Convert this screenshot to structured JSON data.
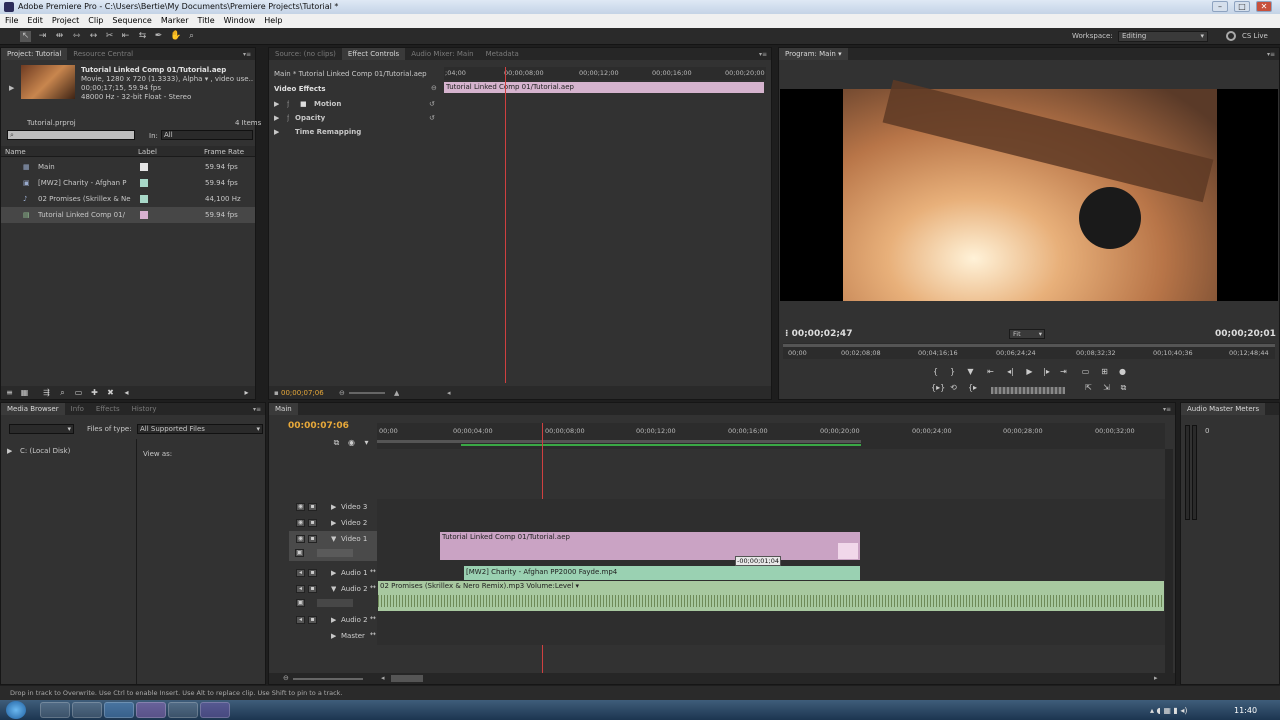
{
  "window": {
    "title": "Adobe Premiere Pro - C:\\Users\\Bertie\\My Documents\\Premiere Projects\\Tutorial *"
  },
  "menu": [
    "File",
    "Edit",
    "Project",
    "Clip",
    "Sequence",
    "Marker",
    "Title",
    "Window",
    "Help"
  ],
  "workspace": {
    "label": "Workspace:",
    "value": "Editing",
    "cslive": "CS Live"
  },
  "project": {
    "tabs": [
      "Project: Tutorial",
      "Resource Central"
    ],
    "preview_title": "Tutorial Linked Comp 01/Tutorial.aep",
    "preview_line1": "Movie, 1280 x 720 (1.3333), Alpha ▾ , video use...",
    "preview_line2": "00;00;17;15, 59.94 fps",
    "preview_line3": "48000 Hz - 32-bit Float - Stereo",
    "file": "Tutorial.prproj",
    "items_count": "4 Items",
    "in_label": "In:",
    "in_value": "All",
    "columns": [
      "Name",
      "Label",
      "Frame Rate"
    ],
    "rows": [
      {
        "name": "Main",
        "rate": "59.94 fps",
        "color": "#e6e6e6"
      },
      {
        "name": "[MW2] Charity - Afghan P",
        "rate": "59.94 fps",
        "color": "#a8d8c8"
      },
      {
        "name": "02 Promises (Skrillex & Ne",
        "rate": "44,100 Hz",
        "color": "#a8d8c8"
      },
      {
        "name": "Tutorial Linked Comp 01/",
        "rate": "59.94 fps",
        "color": "#d8b0d0"
      }
    ]
  },
  "effects": {
    "tabs": [
      "Source: (no clips)",
      "Effect Controls",
      "Audio Mixer: Main",
      "Metadata"
    ],
    "clip_path": "Main * Tutorial Linked Comp 01/Tutorial.aep",
    "ruler": [
      ";04;00",
      "00;00;08;00",
      "00;00;12;00",
      "00;00;16;00",
      "00;00;20;00"
    ],
    "clip_bar": "Tutorial Linked Comp 01/Tutorial.aep",
    "section": "Video Effects",
    "items": [
      "Motion",
      "Opacity",
      "Time Remapping"
    ],
    "timecode": "00;00;07;06"
  },
  "program": {
    "tab": "Program: Main",
    "tc_left": "00;00;02;47",
    "tc_right": "00;00;20;01",
    "fit": "Fit",
    "ruler": [
      "00;00",
      "00;02;08;08",
      "00;04;16;16",
      "00;06;24;24",
      "00;08;32;32",
      "00;10;40;36",
      "00;12;48;44"
    ]
  },
  "media": {
    "tabs": [
      "Media Browser",
      "Info",
      "Effects",
      "History"
    ],
    "files_of_type_label": "Files of type:",
    "files_of_type_value": "All Supported Files",
    "view_as": "View as:",
    "drive": "C: (Local Disk)"
  },
  "timeline": {
    "tab": "Main",
    "timecode": "00:00:07:06",
    "ruler": [
      "00;00",
      "00;00;04;00",
      "00;00;08;00",
      "00;00;12;00",
      "00;00;16;00",
      "00;00;20;00",
      "00;00;24;00",
      "00;00;28;00",
      "00;00;32;00"
    ],
    "tracks": [
      "Video 3",
      "Video 2",
      "Video 1",
      "Audio 1",
      "Audio 2",
      "Audio 2",
      "Master"
    ],
    "clips": {
      "v1": "Tutorial Linked Comp 01/Tutorial.aep",
      "a1": "[MW2] Charity - Afghan PP2000 Fayde.mp4",
      "a2": "02 Promises (Skrillex & Nero Remix).mp3  Volume:Level ▾"
    },
    "tooltip": "-00;00;01;04"
  },
  "audio_meters": {
    "title": "Audio Master Meters",
    "zero": "0"
  },
  "status": "Drop in track to Overwrite. Use Ctrl to enable Insert. Use Alt to replace clip. Use Shift to pin to a track.",
  "taskbar": {
    "clock": "11:40"
  }
}
